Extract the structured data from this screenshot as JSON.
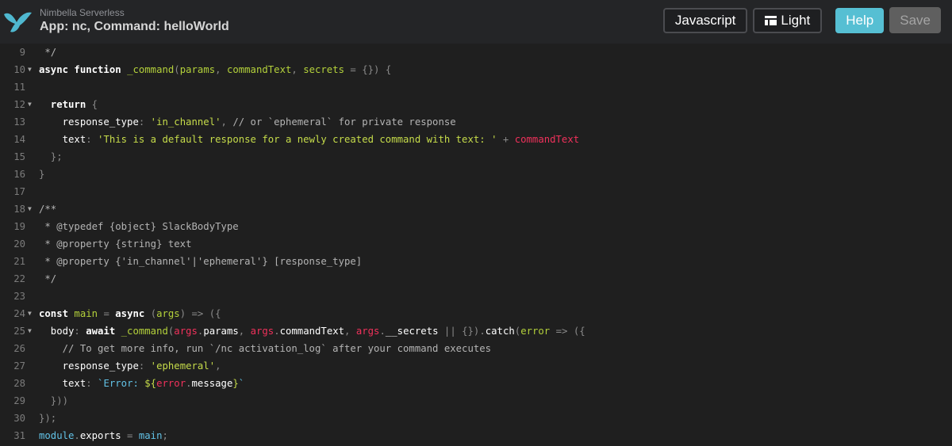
{
  "header": {
    "brand": "Nimbella Serverless",
    "title": "App: nc, Command: helloWorld",
    "buttons": {
      "language": "Javascript",
      "theme": "Light",
      "help": "Help",
      "save": "Save"
    }
  },
  "colors": {
    "accent": "#56bfd3",
    "logo": "#4fb8d0"
  },
  "editor": {
    "lines": [
      {
        "n": "9",
        "fold": false,
        "tokens": [
          [
            " */",
            "c"
          ]
        ]
      },
      {
        "n": "10",
        "fold": true,
        "tokens": [
          [
            "async function ",
            "k"
          ],
          [
            "_command",
            "f"
          ],
          [
            "(",
            "o"
          ],
          [
            "params",
            "p"
          ],
          [
            ", ",
            "o"
          ],
          [
            "commandText",
            "p"
          ],
          [
            ", ",
            "o"
          ],
          [
            "secrets",
            "p"
          ],
          [
            " = {}) {",
            "o"
          ]
        ]
      },
      {
        "n": "11",
        "fold": false,
        "tokens": []
      },
      {
        "n": "12",
        "fold": true,
        "tokens": [
          [
            "  return ",
            "k"
          ],
          [
            "{",
            "o"
          ]
        ]
      },
      {
        "n": "13",
        "fold": false,
        "tokens": [
          [
            "    response_type",
            "w"
          ],
          [
            ": ",
            "o"
          ],
          [
            "'in_channel'",
            "s"
          ],
          [
            ", ",
            "o"
          ],
          [
            "// or `ephemeral` for private response",
            "c"
          ]
        ]
      },
      {
        "n": "14",
        "fold": false,
        "tokens": [
          [
            "    text",
            "w"
          ],
          [
            ": ",
            "o"
          ],
          [
            "'This is a default response for a newly created command with text: '",
            "s"
          ],
          [
            " + ",
            "o"
          ],
          [
            "commandText",
            "r"
          ]
        ]
      },
      {
        "n": "15",
        "fold": false,
        "tokens": [
          [
            "  };",
            "o"
          ]
        ]
      },
      {
        "n": "16",
        "fold": false,
        "tokens": [
          [
            "}",
            "o"
          ]
        ]
      },
      {
        "n": "17",
        "fold": false,
        "tokens": []
      },
      {
        "n": "18",
        "fold": true,
        "tokens": [
          [
            "/**",
            "c"
          ]
        ]
      },
      {
        "n": "19",
        "fold": false,
        "tokens": [
          [
            " * @typedef {object} SlackBodyType",
            "c"
          ]
        ]
      },
      {
        "n": "20",
        "fold": false,
        "tokens": [
          [
            " * @property {string} text",
            "c"
          ]
        ]
      },
      {
        "n": "21",
        "fold": false,
        "tokens": [
          [
            " * @property {'in_channel'|'ephemeral'} [response_type]",
            "c"
          ]
        ]
      },
      {
        "n": "22",
        "fold": false,
        "tokens": [
          [
            " */",
            "c"
          ]
        ]
      },
      {
        "n": "23",
        "fold": false,
        "tokens": []
      },
      {
        "n": "24",
        "fold": true,
        "tokens": [
          [
            "const ",
            "k"
          ],
          [
            "main",
            "f"
          ],
          [
            " = ",
            "o"
          ],
          [
            "async ",
            "k"
          ],
          [
            "(",
            "o"
          ],
          [
            "args",
            "p"
          ],
          [
            ") => ({",
            "o"
          ]
        ]
      },
      {
        "n": "25",
        "fold": true,
        "tokens": [
          [
            "  body",
            "w"
          ],
          [
            ": ",
            "o"
          ],
          [
            "await ",
            "k"
          ],
          [
            "_command",
            "f"
          ],
          [
            "(",
            "o"
          ],
          [
            "args",
            "r"
          ],
          [
            ".",
            "o"
          ],
          [
            "params",
            "w"
          ],
          [
            ", ",
            "o"
          ],
          [
            "args",
            "r"
          ],
          [
            ".",
            "o"
          ],
          [
            "commandText",
            "w"
          ],
          [
            ", ",
            "o"
          ],
          [
            "args",
            "r"
          ],
          [
            ".",
            "o"
          ],
          [
            "__secrets",
            "w"
          ],
          [
            " || {})",
            "o"
          ],
          [
            ".",
            "o"
          ],
          [
            "catch",
            "w"
          ],
          [
            "(",
            "o"
          ],
          [
            "error",
            "p"
          ],
          [
            " => ({",
            "o"
          ]
        ]
      },
      {
        "n": "26",
        "fold": false,
        "tokens": [
          [
            "    // To get more info, run `/nc activation_log` after your command executes",
            "c"
          ]
        ]
      },
      {
        "n": "27",
        "fold": false,
        "tokens": [
          [
            "    response_type",
            "w"
          ],
          [
            ": ",
            "o"
          ],
          [
            "'ephemeral'",
            "s"
          ],
          [
            ",",
            "o"
          ]
        ]
      },
      {
        "n": "28",
        "fold": false,
        "tokens": [
          [
            "    text",
            "w"
          ],
          [
            ": ",
            "o"
          ],
          [
            "`Error: ",
            "b"
          ],
          [
            "${",
            "s"
          ],
          [
            "error",
            "r"
          ],
          [
            ".",
            "o"
          ],
          [
            "message",
            "w"
          ],
          [
            "}",
            "s"
          ],
          [
            "`",
            "b"
          ]
        ]
      },
      {
        "n": "29",
        "fold": false,
        "tokens": [
          [
            "  }))",
            "o"
          ]
        ]
      },
      {
        "n": "30",
        "fold": false,
        "tokens": [
          [
            "});",
            "o"
          ]
        ]
      },
      {
        "n": "31",
        "fold": false,
        "tokens": [
          [
            "module",
            "b"
          ],
          [
            ".",
            "o"
          ],
          [
            "exports",
            "w"
          ],
          [
            " = ",
            "o"
          ],
          [
            "main",
            "b"
          ],
          [
            ";",
            "o"
          ]
        ]
      }
    ]
  }
}
